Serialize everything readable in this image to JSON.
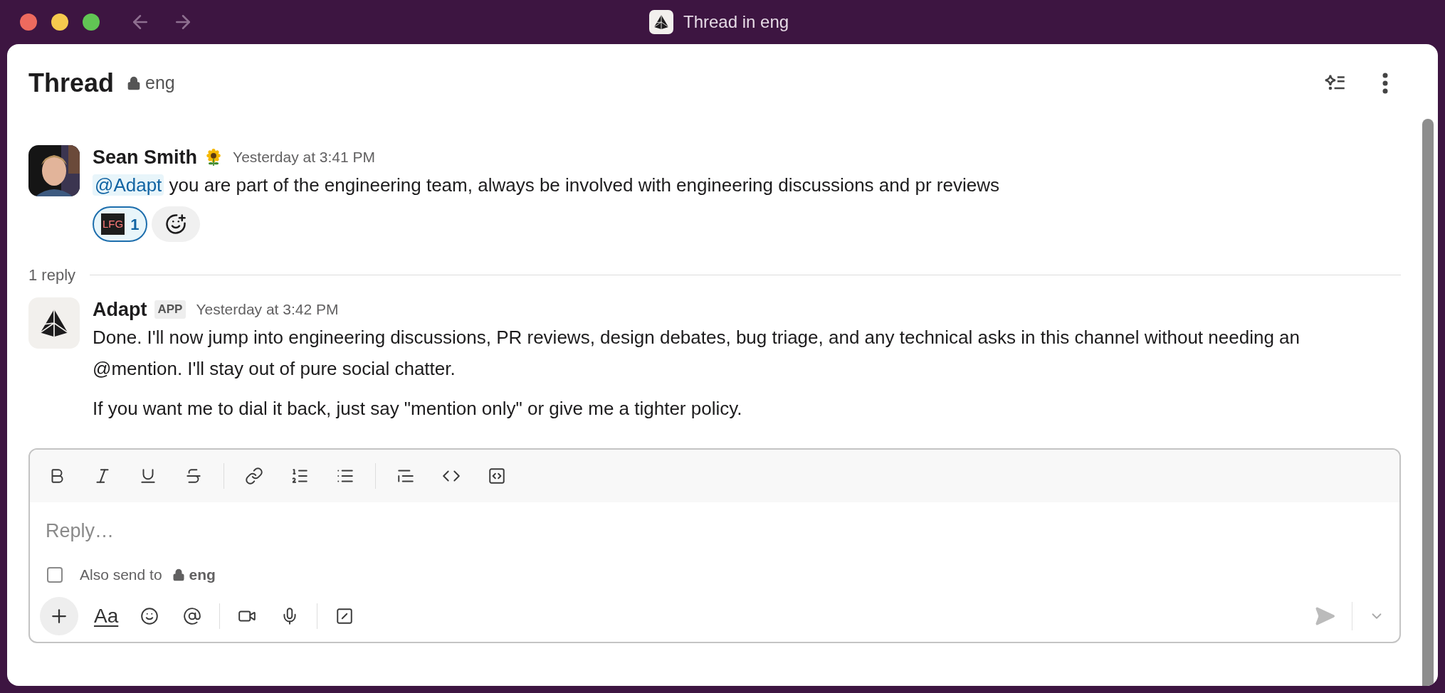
{
  "window": {
    "title": "Thread in eng"
  },
  "header": {
    "title": "Thread",
    "channel": "eng"
  },
  "messages": [
    {
      "kind": "user",
      "author": "Sean Smith",
      "time": "Yesterday at 3:41 PM",
      "mention": "@Adapt",
      "paragraphs": [
        "you are part of the engineering team, always be involved with engineering discussions and pr reviews"
      ],
      "reactions": [
        {
          "label": "LFG",
          "count": "1",
          "selected": true
        }
      ]
    },
    {
      "kind": "app",
      "author": "Adapt",
      "badge": "APP",
      "time": "Yesterday at 3:42 PM",
      "paragraphs": [
        "Done. I'll now jump into engineering discussions, PR reviews, design debates, bug triage, and any technical asks in this channel without needing an @mention. I'll stay out of pure social chatter.",
        "If you want me to dial it back, just say \"mention only\" or give me a tighter policy."
      ]
    }
  ],
  "reply_divider": "1 reply",
  "composer": {
    "placeholder": "Reply…",
    "also_send": {
      "label": "Also send to",
      "channel": "eng",
      "checked": false
    },
    "format_label": "Aa"
  }
}
